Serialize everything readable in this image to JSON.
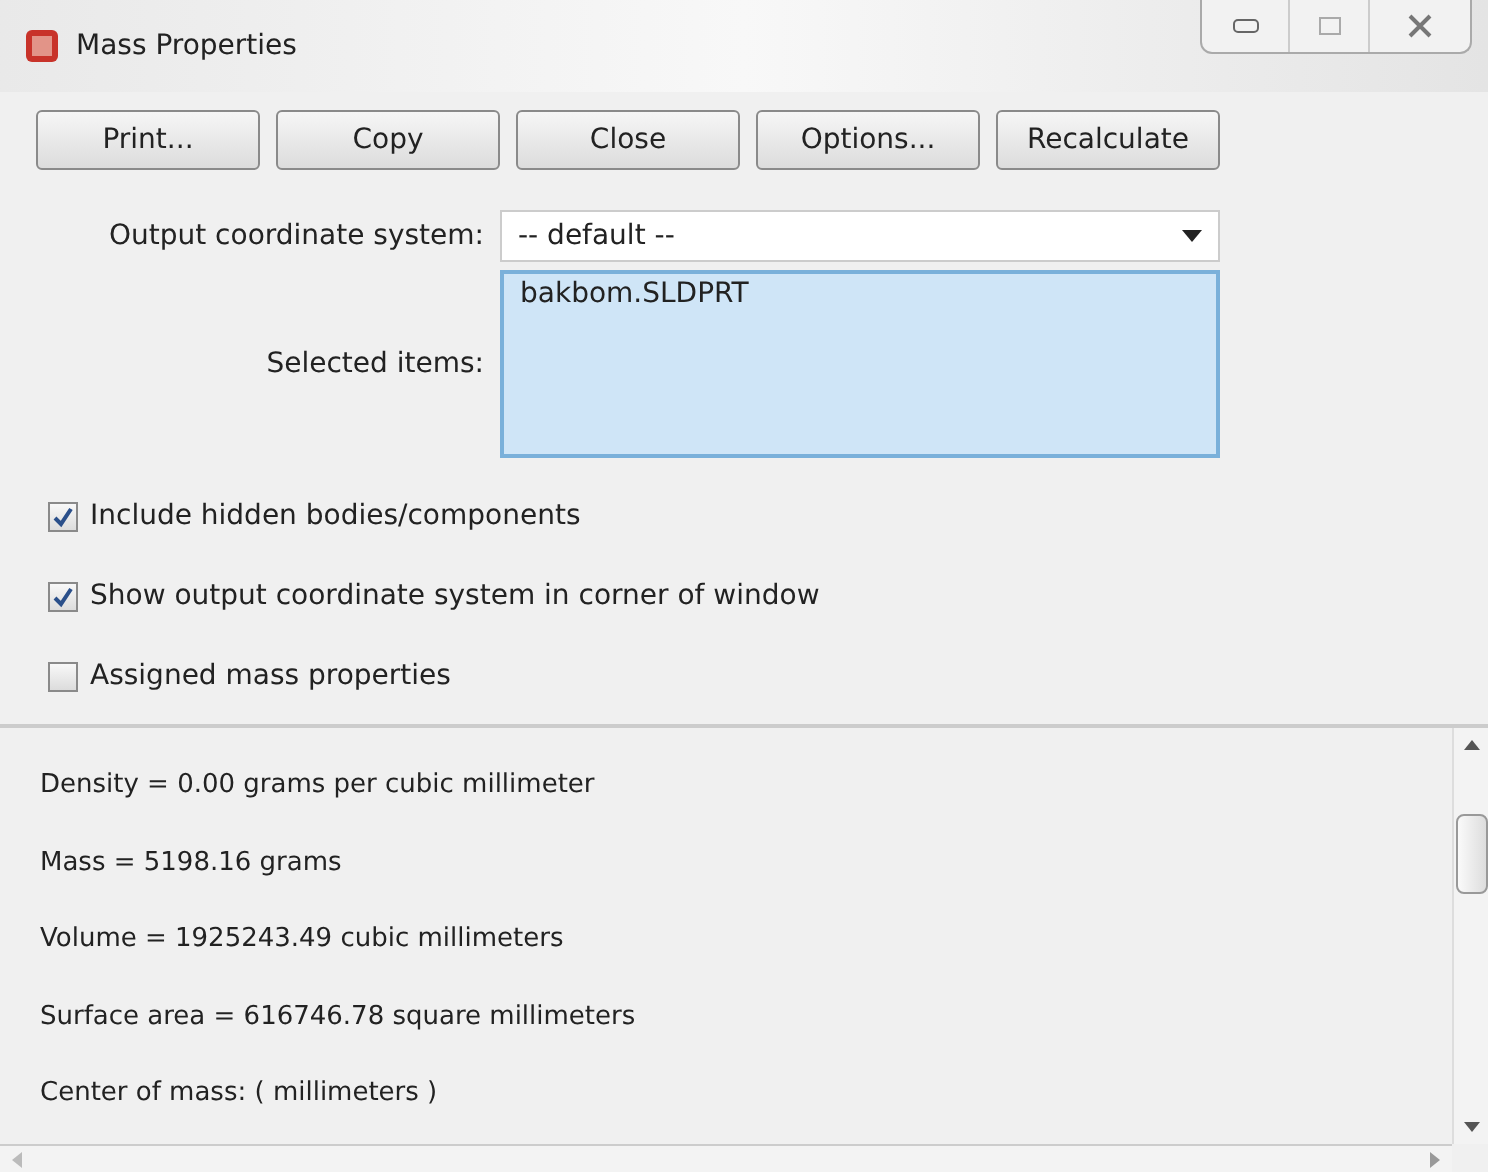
{
  "window": {
    "title": "Mass Properties"
  },
  "buttons": [
    "Print...",
    "Copy",
    "Close",
    "Options...",
    "Recalculate"
  ],
  "output_coordinate_system": {
    "label": "Output coordinate system:",
    "value": "-- default --"
  },
  "selected_items": {
    "label": "Selected items:",
    "items": [
      "bakbom.SLDPRT"
    ]
  },
  "options": [
    {
      "label": "Include hidden bodies/components",
      "checked": true
    },
    {
      "label": "Show output coordinate system in corner of window",
      "checked": true
    },
    {
      "label": "Assigned mass properties",
      "checked": false
    }
  ],
  "results": [
    "Density = 0.00 grams per  cubic millimeter",
    "Mass = 5198.16 grams",
    "Volume = 1925243.49  cubic millimeters",
    "Surface area = 616746.78  square millimeters",
    "Center of mass: ( millimeters )"
  ]
}
